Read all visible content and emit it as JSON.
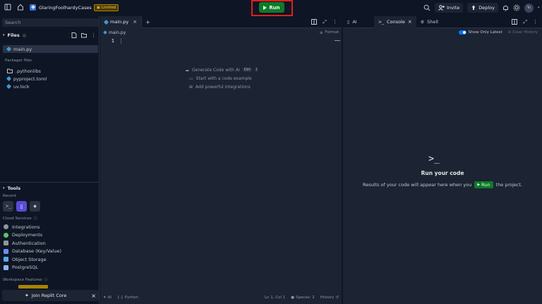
{
  "topbar": {
    "repl_name": "GlaringFoolhardyCases",
    "plan_badge": "Limited",
    "run_label": "Run",
    "invite_label": "Invite",
    "deploy_label": "Deploy",
    "avatar_initials": "Yu"
  },
  "sidebar": {
    "search_placeholder": "Search",
    "files_header": "Files",
    "files": [
      {
        "name": "main.py"
      }
    ],
    "packager_header": "Packager files",
    "packager_files": [
      {
        "name": ".pythonlibs"
      },
      {
        "name": "pyproject.toml"
      },
      {
        "name": "uv.lock"
      }
    ],
    "tools_header": "Tools",
    "recent_label": "Recent",
    "cloud_services_label": "Cloud Services",
    "cloud_services": [
      {
        "label": "Integrations",
        "color": "#8f959c"
      },
      {
        "label": "Deployments",
        "color": "#5ec26a"
      },
      {
        "label": "Authentication",
        "color": "#8f959c"
      },
      {
        "label": "Database (Key/Value)",
        "color": "#6b8cff"
      },
      {
        "label": "Object Storage",
        "color": "#5aa9e6"
      },
      {
        "label": "PostgreSQL",
        "color": "#8fb3ff"
      }
    ],
    "workspace_features_label": "Workspace Features",
    "join_label": "Join Replit Core"
  },
  "editor": {
    "tab_label": "main.py",
    "breadcrumb": "main.py",
    "format_label": "Format",
    "line_number": "1",
    "hints": [
      {
        "text": "Generate Code with AI",
        "kbd": [
          "Ctrl",
          "I"
        ]
      },
      {
        "text": "Start with a code example"
      },
      {
        "text": "Add powerful Integrations"
      }
    ],
    "status": {
      "ai": "AI",
      "language": "Python",
      "cursor": "Ln 1, Col 1",
      "spaces": "Spaces: 2",
      "history": "History"
    }
  },
  "right_pane": {
    "tabs": [
      {
        "label": "AI"
      },
      {
        "label": "Console"
      },
      {
        "label": "Shell"
      }
    ],
    "show_only_latest_label": "Show Only Latest",
    "clear_history_label": "Clear History",
    "empty_title": "Run your code",
    "empty_prefix": "Results of your code will appear here when you",
    "empty_run": "Run",
    "empty_suffix": "the project."
  },
  "colors": {
    "run_green": "#0d7a29",
    "highlight_red": "#e01e1e",
    "accent_blue": "#0079f2"
  }
}
